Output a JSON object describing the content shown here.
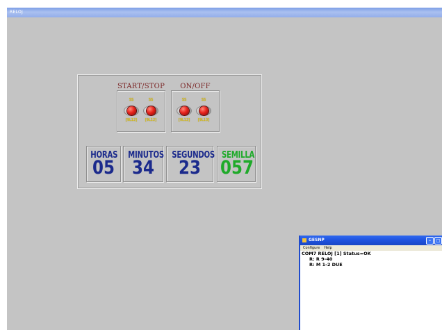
{
  "main_window": {
    "title": "RELOJ"
  },
  "controls": {
    "start_stop": {
      "title": "START/STOP",
      "buttons": [
        {
          "top_label": "SS",
          "bottom_label": "[9L12]"
        },
        {
          "top_label": "SS",
          "bottom_label": "[9L12]"
        }
      ]
    },
    "on_off": {
      "title": "ON/OFF",
      "buttons": [
        {
          "top_label": "SS",
          "bottom_label": "[9L12]"
        },
        {
          "top_label": "SS",
          "bottom_label": "[9L13]"
        }
      ]
    }
  },
  "displays": {
    "horas": {
      "label": "HORAS",
      "value": "05"
    },
    "minutos": {
      "label": "MINUTOS",
      "value": "34"
    },
    "segundos": {
      "label": "SEGUNDOS",
      "value": "23"
    },
    "semilla": {
      "label": "SEMILLA",
      "value": "057"
    }
  },
  "colors": {
    "display_blue": "#1b2a8c",
    "display_green": "#1faa2a"
  },
  "gesnp_window": {
    "title": "GESNP",
    "menu": [
      "Configure",
      "Help"
    ],
    "lines": [
      "COM7 RELOJ [1] Status=OK",
      "R: R 9-40",
      "R: M 1-2 DUE"
    ]
  }
}
